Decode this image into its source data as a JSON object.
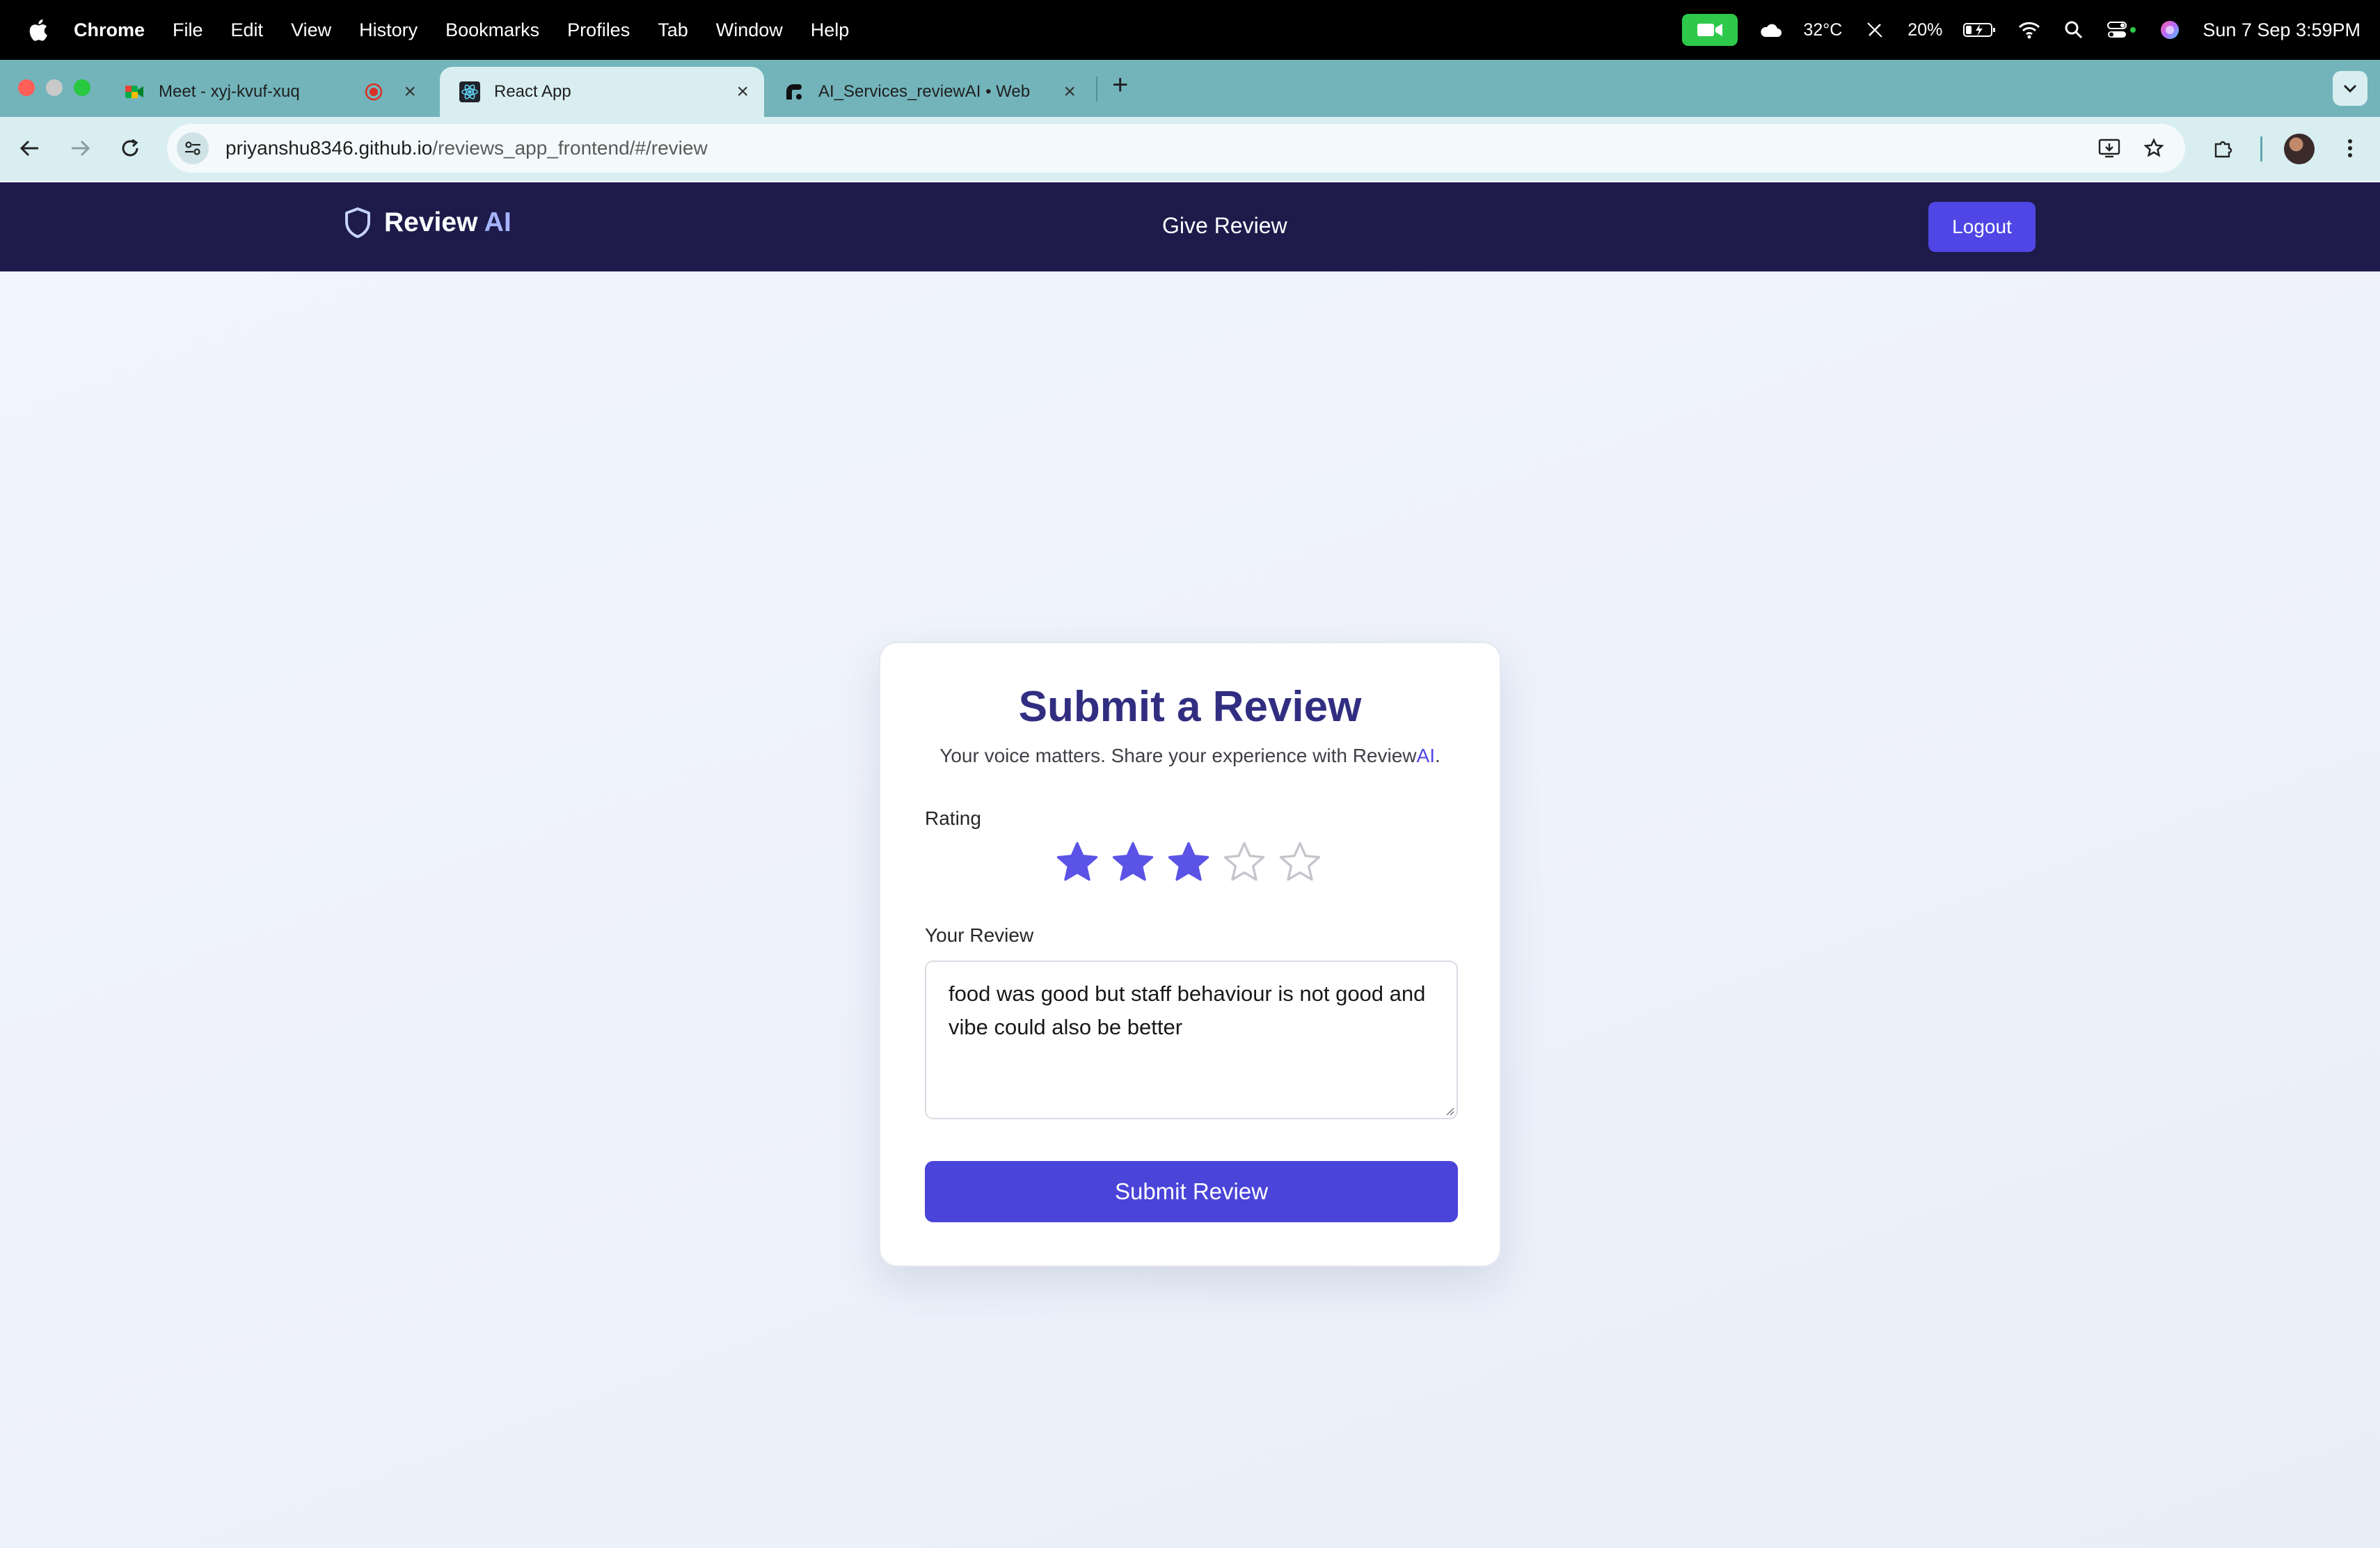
{
  "menubar": {
    "app": "Chrome",
    "items": [
      "File",
      "Edit",
      "View",
      "History",
      "Bookmarks",
      "Profiles",
      "Tab",
      "Window",
      "Help"
    ],
    "weather": "32°C",
    "battery": "20%",
    "datetime": "Sun 7 Sep  3:59PM"
  },
  "browser": {
    "tabs": [
      {
        "title": "Meet - xyj-kvuf-xuq",
        "icon": "meet-icon",
        "recording": true
      },
      {
        "title": "React App",
        "icon": "react-icon",
        "active": true
      },
      {
        "title": "AI_Services_reviewAI • Web",
        "icon": "render-icon"
      }
    ],
    "new_tab_label": "+",
    "url_host": "priyanshu8346.github.io",
    "url_path": "/reviews_app_frontend/#/review"
  },
  "app": {
    "brand_name": "Review",
    "brand_ai": "AI",
    "nav_link": "Give Review",
    "logout_label": "Logout"
  },
  "form": {
    "title": "Submit a Review",
    "subtitle_prefix": "Your voice matters. Share your experience with Review",
    "subtitle_ai": "AI",
    "subtitle_suffix": ".",
    "rating_label": "Rating",
    "rating_value": 3,
    "rating_max": 5,
    "review_label": "Your Review",
    "review_value": "food was good but staff behaviour is not good and vibe could also be better",
    "submit_label": "Submit Review"
  },
  "colors": {
    "navbar": "#1e1b4b",
    "accent": "#4f46e5",
    "title": "#312e81",
    "star_filled": "#5b52e6",
    "star_empty": "#c4c4cc",
    "tabstrip": "#73b4bb"
  }
}
